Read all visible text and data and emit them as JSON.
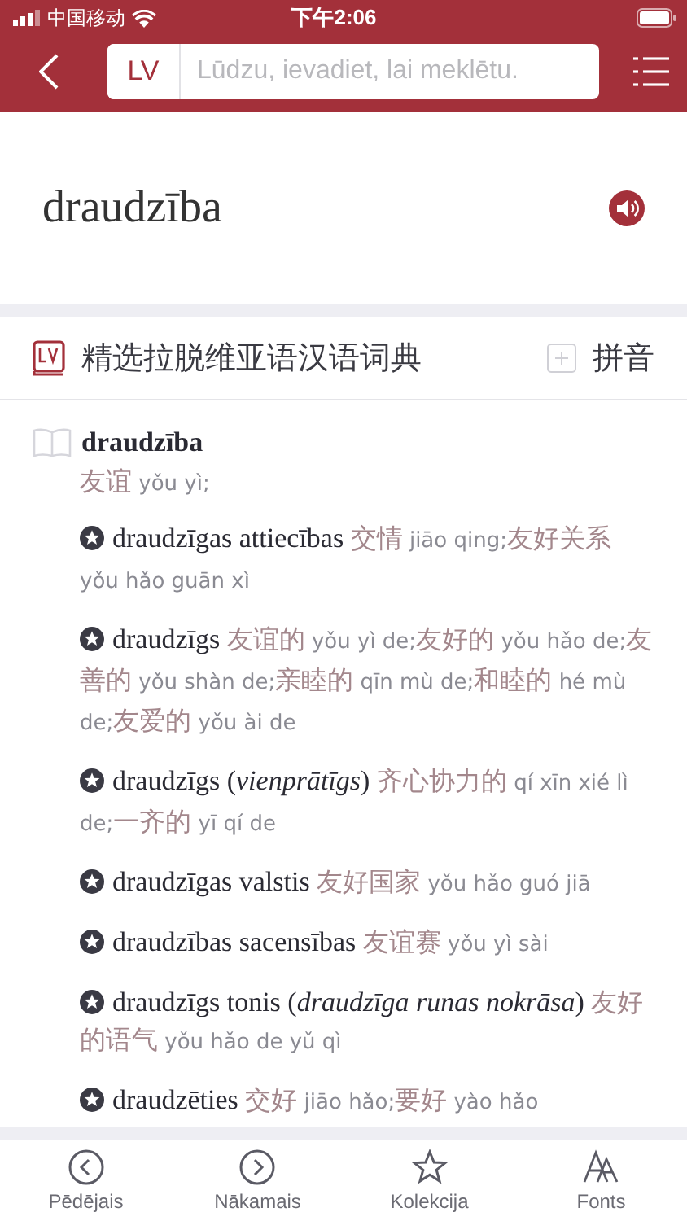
{
  "status_bar": {
    "carrier": "中国移动",
    "time": "下午2:06"
  },
  "search": {
    "language": "LV",
    "placeholder": "Lūdzu, ievadiet, lai meklētu."
  },
  "headword": "draudzība",
  "dictionary": {
    "title": "精选拉脱维亚语汉语词典",
    "pinyin_label": "拼音",
    "pinyin_on": false
  },
  "entry": {
    "word": "draudzība",
    "definition": [
      {
        "kind": "zh",
        "text": "友谊"
      },
      {
        "kind": "py",
        "text": " yǒu yì;"
      }
    ],
    "examples": [
      [
        {
          "kind": "lv",
          "text": "draudzīgas attiecības "
        },
        {
          "kind": "zh",
          "text": "交情"
        },
        {
          "kind": "py",
          "text": " jiāo qing;"
        },
        {
          "kind": "zh",
          "text": "友好关系"
        },
        {
          "kind": "py",
          "text": " yǒu hǎo guān xì"
        }
      ],
      [
        {
          "kind": "lv",
          "text": "draudzīgs "
        },
        {
          "kind": "zh",
          "text": "友谊的"
        },
        {
          "kind": "py",
          "text": " yǒu yì de;"
        },
        {
          "kind": "zh",
          "text": "友好的"
        },
        {
          "kind": "py",
          "text": " yǒu hǎo de;"
        },
        {
          "kind": "zh",
          "text": "友善的"
        },
        {
          "kind": "py",
          "text": " yǒu shàn de;"
        },
        {
          "kind": "zh",
          "text": "亲睦的"
        },
        {
          "kind": "py",
          "text": " qīn mù de;"
        },
        {
          "kind": "zh",
          "text": "和睦的"
        },
        {
          "kind": "py",
          "text": " hé mù de;"
        },
        {
          "kind": "zh",
          "text": "友爱的"
        },
        {
          "kind": "py",
          "text": " yǒu ài de"
        }
      ],
      [
        {
          "kind": "lv",
          "text": "draudzīgs ("
        },
        {
          "kind": "lv_italic",
          "text": "vienprātīgs"
        },
        {
          "kind": "lv",
          "text": ") "
        },
        {
          "kind": "zh",
          "text": "齐心协力的"
        },
        {
          "kind": "py",
          "text": " qí xīn xié lì de;"
        },
        {
          "kind": "zh",
          "text": "一齐的"
        },
        {
          "kind": "py",
          "text": " yī qí de"
        }
      ],
      [
        {
          "kind": "lv",
          "text": "draudzīgas valstis "
        },
        {
          "kind": "zh",
          "text": "友好国家"
        },
        {
          "kind": "py",
          "text": " yǒu hǎo guó jiā"
        }
      ],
      [
        {
          "kind": "lv",
          "text": "draudzības sacensības "
        },
        {
          "kind": "zh",
          "text": "友谊赛"
        },
        {
          "kind": "py",
          "text": " yǒu yì sài"
        }
      ],
      [
        {
          "kind": "lv",
          "text": "draudzīgs tonis ("
        },
        {
          "kind": "lv_italic",
          "text": "draudzīga runas nokrāsa"
        },
        {
          "kind": "lv",
          "text": ") "
        },
        {
          "kind": "zh",
          "text": "友好的语气"
        },
        {
          "kind": "py",
          "text": " yǒu hǎo de yǔ qì"
        }
      ],
      [
        {
          "kind": "lv",
          "text": "draudzēties "
        },
        {
          "kind": "zh",
          "text": "交好"
        },
        {
          "kind": "py",
          "text": " jiāo hǎo;"
        },
        {
          "kind": "zh",
          "text": "要好"
        },
        {
          "kind": "py",
          "text": " yào hǎo"
        }
      ]
    ]
  },
  "tab_bar": [
    {
      "label": "Pēdējais",
      "kind": "prev"
    },
    {
      "label": "Nākamais",
      "kind": "next"
    },
    {
      "label": "Kolekcija",
      "kind": "star"
    },
    {
      "label": "Fonts",
      "kind": "fonts"
    }
  ]
}
